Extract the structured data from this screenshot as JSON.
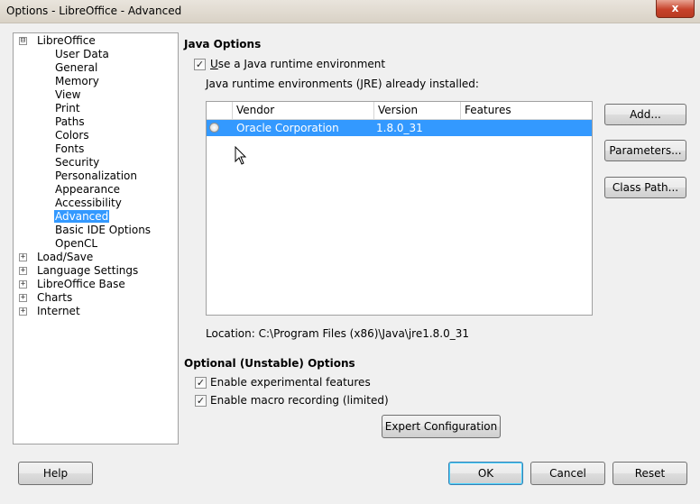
{
  "window": {
    "title": "Options - LibreOffice - Advanced",
    "close_label": "x"
  },
  "tree": {
    "root_label": "LibreOffice",
    "root_expander": "⊟",
    "children": [
      "User Data",
      "General",
      "Memory",
      "View",
      "Print",
      "Paths",
      "Colors",
      "Fonts",
      "Security",
      "Personalization",
      "Appearance",
      "Accessibility",
      "Advanced",
      "Basic IDE Options",
      "OpenCL"
    ],
    "selected": "Advanced",
    "collapsed": [
      "Load/Save",
      "Language Settings",
      "LibreOffice Base",
      "Charts",
      "Internet"
    ],
    "collapsed_expander": "+"
  },
  "java": {
    "heading": "Java Options",
    "use_jre_label": "Use a Java runtime environment",
    "use_jre_mnemonic": "U",
    "use_jre_rest": "se a Java runtime environment",
    "use_jre_checked": true,
    "installed_label": "Java runtime environments (JRE) already installed:",
    "columns": [
      "",
      "Vendor",
      "Version",
      "Features"
    ],
    "rows": [
      {
        "vendor": "Oracle Corporation",
        "version": "1.8.0_31",
        "features": "",
        "selected": true
      }
    ],
    "location_label": "Location: C:\\Program Files (x86)\\Java\\jre1.8.0_31",
    "add_label": "Add...",
    "parameters_label": "Parameters...",
    "classpath_label": "Class Path..."
  },
  "optional": {
    "heading": "Optional (Unstable) Options",
    "experimental_label": "Enable experimental features",
    "experimental_checked": true,
    "macro_label": "Enable macro recording (limited)",
    "macro_checked": true,
    "expert_label": "Expert Configuration"
  },
  "footer": {
    "help_label": "Help",
    "ok_label": "OK",
    "cancel_label": "Cancel",
    "reset_label": "Reset"
  },
  "check_mark": "✓"
}
